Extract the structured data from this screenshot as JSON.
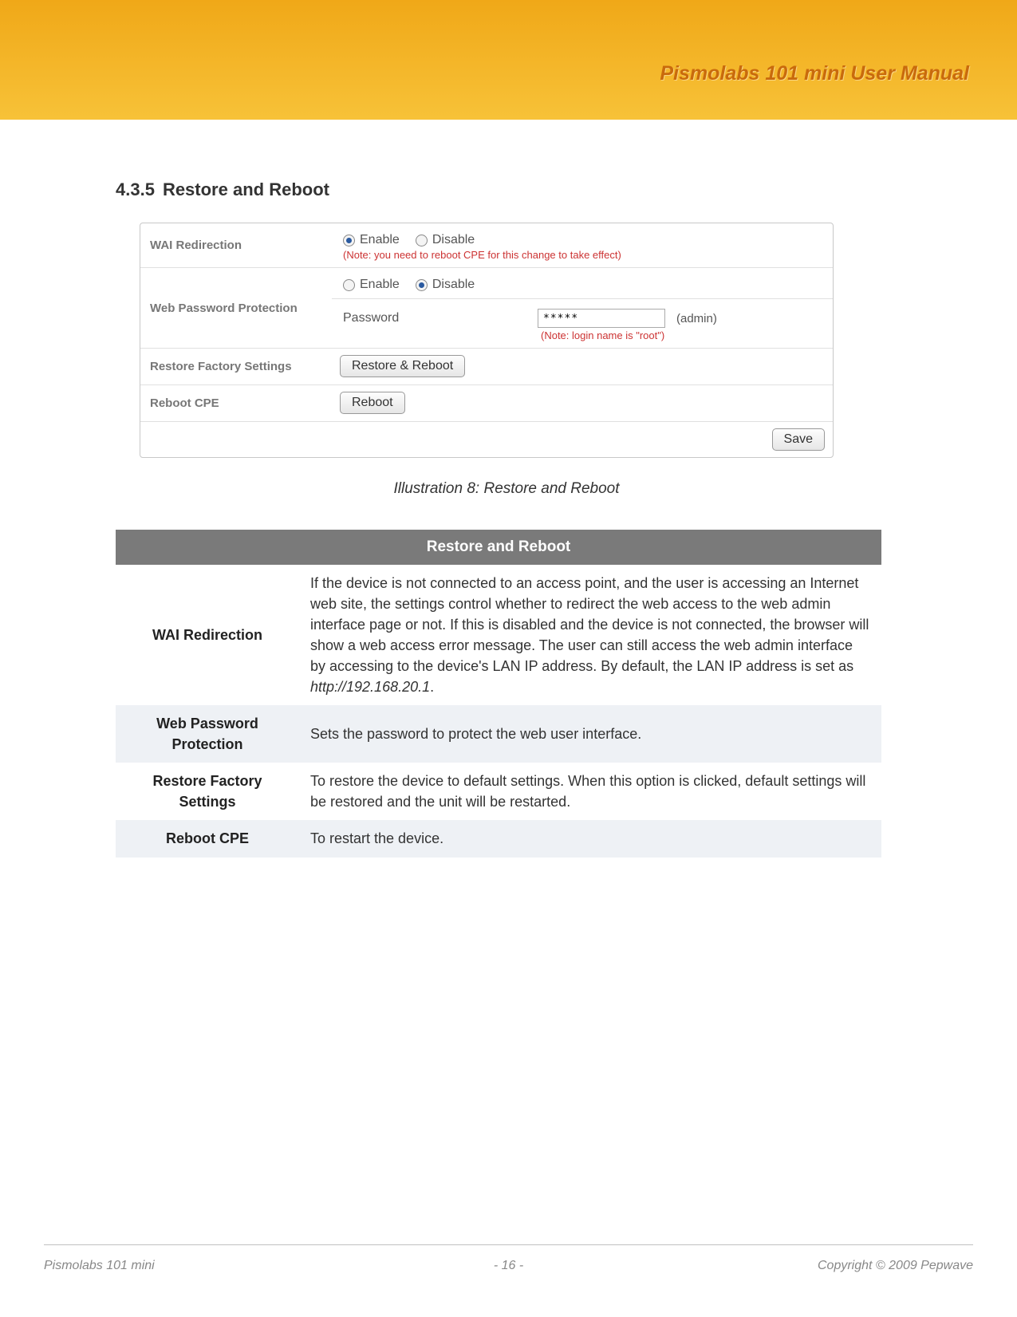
{
  "header": {
    "title": "Pismolabs 101 mini User Manual"
  },
  "section": {
    "number": "4.3.5",
    "title": "Restore and Reboot"
  },
  "illus": {
    "rows": {
      "wai": {
        "label": "WAI Redirection",
        "opt_enable": "Enable",
        "opt_disable": "Disable",
        "note": "(Note: you need to reboot CPE for this change to take effect)"
      },
      "wpp": {
        "label": "Web Password Protection",
        "opt_enable": "Enable",
        "opt_disable": "Disable",
        "pw_label": "Password",
        "pw_value": "*****",
        "pw_suffix": "(admin)",
        "pw_note": "(Note: login name is \"root\")"
      },
      "rfs": {
        "label": "Restore Factory Settings",
        "button": "Restore & Reboot"
      },
      "reboot": {
        "label": "Reboot CPE",
        "button": "Reboot"
      }
    },
    "save": "Save"
  },
  "caption": "Illustration 8: Restore and Reboot",
  "desc": {
    "band": "Restore and Reboot",
    "rows": [
      {
        "term": "WAI Redirection",
        "text_pre": "If the device is not connected to an access point, and the user is accessing an Internet web site, the settings control whether to redirect the web access to the web admin interface page or not.  If this is disabled and the device is not connected, the browser will show a web access error message.  The user can still access the web admin interface by accessing to the device's LAN IP address.  By default, the LAN IP address is set as ",
        "text_ital": "http://192.168.20.1",
        "text_post": "."
      },
      {
        "term": "Web Password Protection",
        "text": "Sets the password to protect the web user interface."
      },
      {
        "term": "Restore Factory Settings",
        "text": "To restore the device to default settings.  When this option is clicked, default settings will be restored and the unit will be restarted."
      },
      {
        "term": "Reboot CPE",
        "text": "To restart the device."
      }
    ]
  },
  "footer": {
    "left": "Pismolabs 101 mini",
    "center": "- 16 -",
    "right": "Copyright © 2009 Pepwave"
  }
}
